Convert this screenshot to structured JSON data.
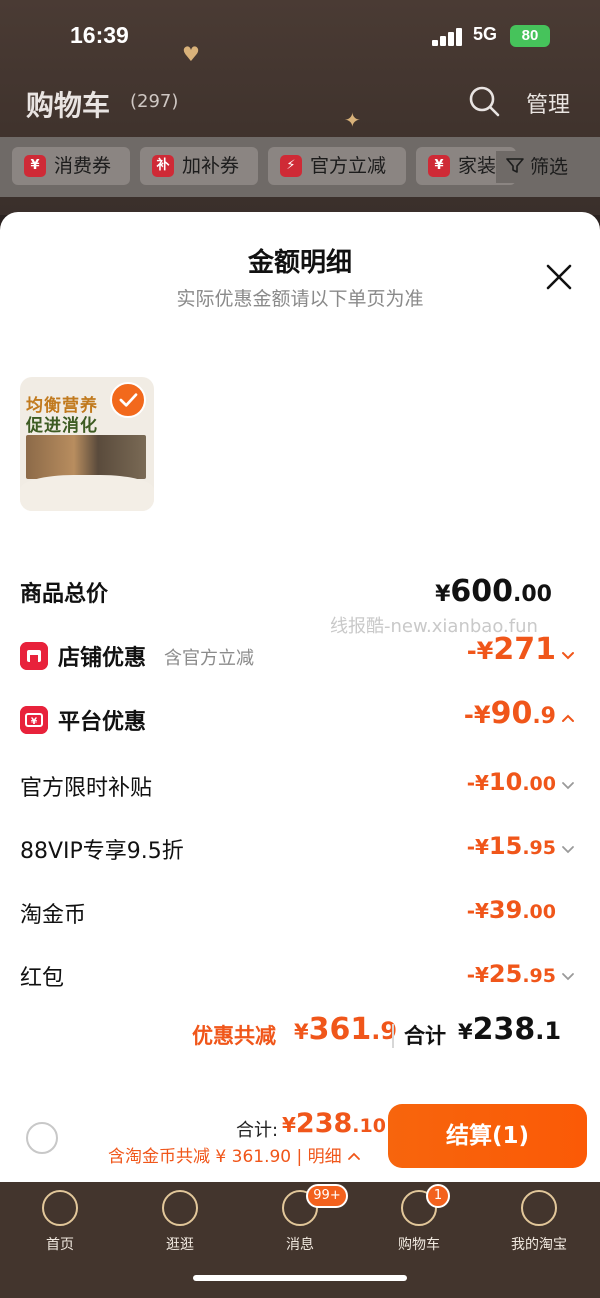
{
  "status_bar": {
    "time": "16:39",
    "network": "5G",
    "battery": "80"
  },
  "cart_header": {
    "title": "购物车",
    "count": "(297)",
    "manage": "管理"
  },
  "filter_chips": [
    {
      "icon": "¥",
      "label": "消费券"
    },
    {
      "icon": "补",
      "label": "加补券"
    },
    {
      "icon": "⚡",
      "label": "官方立减"
    },
    {
      "icon": "¥",
      "label": "家装"
    }
  ],
  "filter_button": "筛选",
  "sheet": {
    "title": "金额明细",
    "subtitle": "实际优惠金额请以下单页为准",
    "product_image_text": [
      "均衡营养",
      "促进消化"
    ],
    "total_label": "商品总价",
    "total_price": {
      "symbol": "¥",
      "int": "600",
      "dec": ".00"
    },
    "store_discount": {
      "label": "店铺优惠",
      "note": "含官方立减",
      "symbol": "-¥",
      "int": "271",
      "dec": ""
    },
    "platform_discount": {
      "label": "平台优惠",
      "symbol": "-¥",
      "int": "90",
      "dec": ".9"
    },
    "platform_items": [
      {
        "label": "官方限时补贴",
        "symbol": "-¥",
        "int": "10",
        "dec": ".00",
        "expandable": true
      },
      {
        "label": "88VIP专享9.5折",
        "symbol": "-¥",
        "int": "15",
        "dec": ".95",
        "expandable": true
      },
      {
        "label": "淘金币",
        "symbol": "-¥",
        "int": "39",
        "dec": ".00",
        "expandable": false
      },
      {
        "label": "红包",
        "symbol": "-¥",
        "int": "25",
        "dec": ".95",
        "expandable": true
      }
    ],
    "summary": {
      "discount_label": "优惠共减",
      "discount": {
        "symbol": "¥",
        "int": "361",
        "dec": ".9"
      },
      "total_label": "合计",
      "total": {
        "symbol": "¥",
        "int": "238",
        "dec": ".1"
      }
    }
  },
  "watermark": "线报酷-new.xianbao.fun",
  "checkout": {
    "total_label": "合计:",
    "total": {
      "symbol": "¥",
      "int": "238",
      "dec": ".10"
    },
    "sub_text": "含淘金币共减 ¥ 361.90 | 明细",
    "pay_button": "结算(1)"
  },
  "tabbar": [
    {
      "label": "首页",
      "badge": ""
    },
    {
      "label": "逛逛",
      "badge": ""
    },
    {
      "label": "消息",
      "badge": "99+"
    },
    {
      "label": "购物车",
      "badge": "1"
    },
    {
      "label": "我的淘宝",
      "badge": ""
    }
  ],
  "colors": {
    "accent": "#f0561a",
    "pay_button": "#f7650d",
    "tab_bar": "#43352d",
    "icon_red": "#e8223b"
  }
}
